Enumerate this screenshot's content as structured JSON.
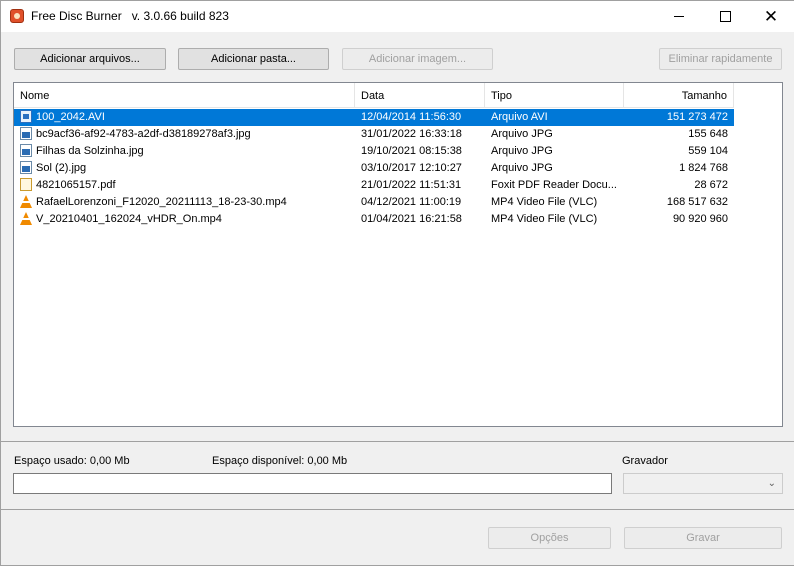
{
  "window": {
    "title": "Free Disc Burner   v. 3.0.66 build 823",
    "controls": {
      "minimize": "minimize",
      "maximize": "maximize",
      "close": "✕"
    }
  },
  "toolbar": {
    "add_files": "Adicionar arquivos...",
    "add_folder": "Adicionar pasta...",
    "add_image": "Adicionar imagem...",
    "quick_erase": "Eliminar rapidamente"
  },
  "list": {
    "columns": [
      "Nome",
      "Data",
      "Tipo",
      "Tamanho"
    ],
    "rows": [
      {
        "name": "100_2042.AVI",
        "date": "12/04/2014 11:56:30",
        "type": "Arquivo AVI",
        "size": "151 273 472",
        "icon": "avi-file-icon",
        "selected": true
      },
      {
        "name": "bc9acf36-af92-4783-a2df-d38189278af3.jpg",
        "date": "31/01/2022 16:33:18",
        "type": "Arquivo JPG",
        "size": "155 648",
        "icon": "jpg-file-icon",
        "selected": false
      },
      {
        "name": "Filhas da Solzinha.jpg",
        "date": "19/10/2021 08:15:38",
        "type": "Arquivo JPG",
        "size": "559 104",
        "icon": "jpg-file-icon",
        "selected": false
      },
      {
        "name": "Sol (2).jpg",
        "date": "03/10/2017 12:10:27",
        "type": "Arquivo JPG",
        "size": "1 824 768",
        "icon": "jpg-file-icon",
        "selected": false
      },
      {
        "name": "4821065157.pdf",
        "date": "21/01/2022 11:51:31",
        "type": "Foxit PDF Reader Docu...",
        "size": "28 672",
        "icon": "pdf-file-icon",
        "selected": false
      },
      {
        "name": "RafaelLorenzoni_F12020_20211113_18-23-30.mp4",
        "date": "04/12/2021 11:00:19",
        "type": "MP4 Video File (VLC)",
        "size": "168 517 632",
        "icon": "vlc-file-icon",
        "selected": false
      },
      {
        "name": "V_20210401_162024_vHDR_On.mp4",
        "date": "01/04/2021 16:21:58",
        "type": "MP4 Video File (VLC)",
        "size": "90 920 960",
        "icon": "vlc-file-icon",
        "selected": false
      }
    ]
  },
  "status": {
    "used_space": "Espaço usado: 0,00 Mb",
    "free_space": "Espaço disponível: 0,00 Mb",
    "burner_label": "Gravador",
    "burner_value": "",
    "progress": 0
  },
  "footer": {
    "options": "Opções",
    "burn": "Gravar"
  },
  "colors": {
    "selection": "#0078d7",
    "window_bg": "#f0f0f0",
    "disabled_text": "#a0a0a0"
  }
}
